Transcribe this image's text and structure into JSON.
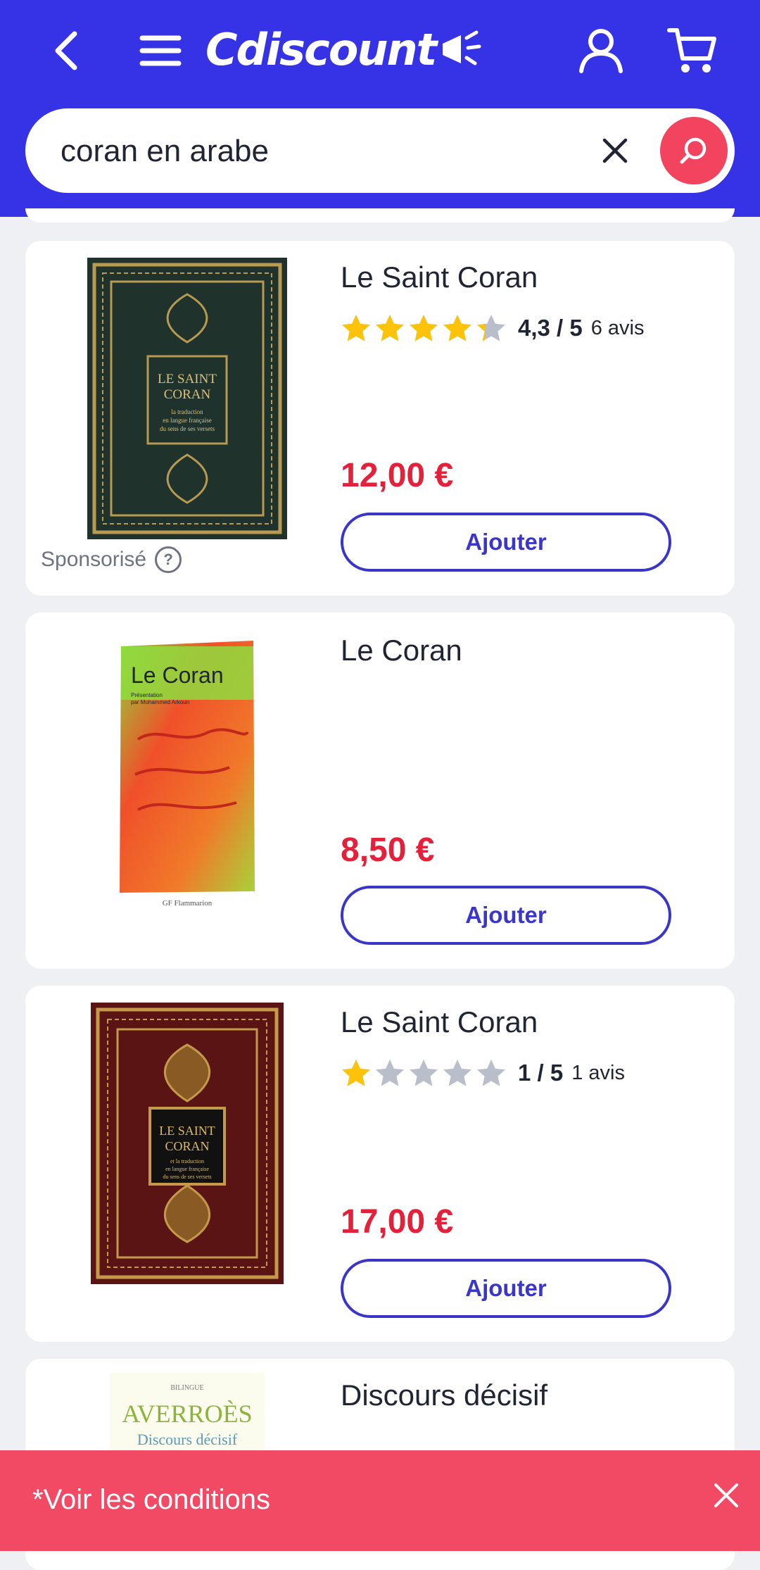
{
  "header": {
    "brand": "Cdiscount",
    "back_icon": "chevron-left-icon",
    "menu_icon": "hamburger-menu-icon",
    "account_icon": "user-icon",
    "cart_icon": "shopping-cart-icon",
    "background": "#3633e6"
  },
  "search": {
    "value": "coran en arabe",
    "clear_icon": "close-icon",
    "search_icon": "search-icon",
    "button_color": "#f2445f"
  },
  "products": [
    {
      "title": "Le Saint Coran",
      "rating": 4.3,
      "rating_label": "4,3 / 5",
      "reviews_label": "6 avis",
      "price": "12,00 €",
      "button": "Ajouter",
      "sponsored_label": "Sponsorisé",
      "sponsored_help": "?",
      "cover": {
        "color": "#1f332c",
        "accent": "#b89a52",
        "title_line1": "LE SAINT",
        "title_line2": "CORAN",
        "sub1": "la traduction",
        "sub2": "en langue française",
        "sub3": "du sens de ses versets"
      }
    },
    {
      "title": "Le Coran",
      "price": "8,50 €",
      "button": "Ajouter",
      "cover": {
        "title": "Le Coran",
        "sub1": "Présentation",
        "sub2": "par Mohammed Arkoun",
        "publisher": "GF Flammarion"
      }
    },
    {
      "title": "Le Saint Coran",
      "rating": 1,
      "rating_label": "1 / 5",
      "reviews_label": "1 avis",
      "price": "17,00 €",
      "button": "Ajouter",
      "cover": {
        "color": "#5a1414",
        "accent": "#c49a4a",
        "title_line1": "LE SAINT",
        "title_line2": "CORAN",
        "sub1": "et la traduction",
        "sub2": "en langue française",
        "sub3": "du sens de ses versets"
      }
    },
    {
      "title": "Discours décisif",
      "cover": {
        "top": "BILINGUE",
        "author": "AVERROÈS",
        "title": "Discours décisif"
      }
    }
  ],
  "banner": {
    "text": "*Voir les conditions",
    "close_icon": "close-icon",
    "color": "#f24a64"
  }
}
